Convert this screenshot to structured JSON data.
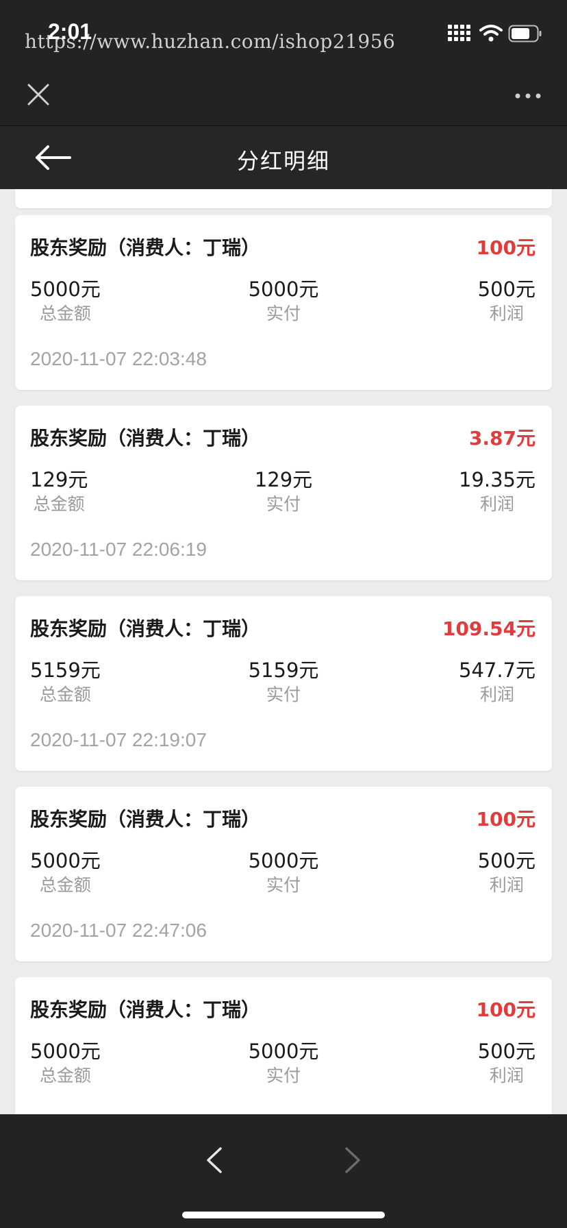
{
  "status_bar": {
    "time": "2:01",
    "watermark": "https://www.huzhan.com/ishop21956"
  },
  "browser_bar": {
    "close_icon": "close-icon",
    "more_icon": "more-icon"
  },
  "header": {
    "title": "分红明细",
    "back_icon": "arrow-left-icon"
  },
  "colors": {
    "accent_red": "#e23b3b",
    "dark_bar": "#232323",
    "page_bg": "#ececec"
  },
  "records": [
    {
      "title": "股东奖励（消费人：丁瑞）",
      "amount": "100元",
      "total_value": "5000元",
      "total_label": "总金额",
      "paid_value": "5000元",
      "paid_label": "实付",
      "profit_value": "500元",
      "profit_label": "利润",
      "time": "2020-11-07 22:03:48"
    },
    {
      "title": "股东奖励（消费人：丁瑞）",
      "amount": "3.87元",
      "total_value": "129元",
      "total_label": "总金额",
      "paid_value": "129元",
      "paid_label": "实付",
      "profit_value": "19.35元",
      "profit_label": "利润",
      "time": "2020-11-07 22:06:19"
    },
    {
      "title": "股东奖励（消费人：丁瑞）",
      "amount": "109.54元",
      "total_value": "5159元",
      "total_label": "总金额",
      "paid_value": "5159元",
      "paid_label": "实付",
      "profit_value": "547.7元",
      "profit_label": "利润",
      "time": "2020-11-07 22:19:07"
    },
    {
      "title": "股东奖励（消费人：丁瑞）",
      "amount": "100元",
      "total_value": "5000元",
      "total_label": "总金额",
      "paid_value": "5000元",
      "paid_label": "实付",
      "profit_value": "500元",
      "profit_label": "利润",
      "time": "2020-11-07 22:47:06"
    },
    {
      "title": "股东奖励（消费人：丁瑞）",
      "amount": "100元",
      "total_value": "5000元",
      "total_label": "总金额",
      "paid_value": "5000元",
      "paid_label": "实付",
      "profit_value": "500元",
      "profit_label": "利润",
      "time": ""
    }
  ],
  "bottom_bar": {
    "back_icon": "chevron-left-icon",
    "forward_icon": "chevron-right-icon"
  }
}
